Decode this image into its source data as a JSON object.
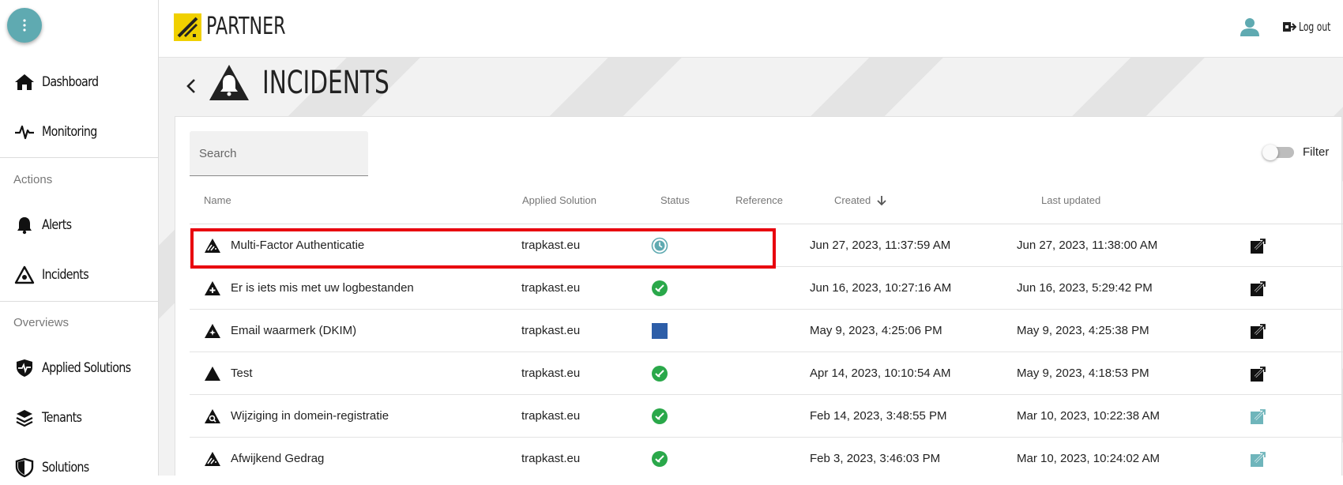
{
  "sidebar": {
    "nav": [
      {
        "label": "Dashboard",
        "icon": "home-icon"
      },
      {
        "label": "Monitoring",
        "icon": "pulse-icon"
      }
    ],
    "sections": [
      {
        "title": "Actions",
        "items": [
          {
            "label": "Alerts",
            "icon": "bell-icon"
          },
          {
            "label": "Incidents",
            "icon": "warning-triangle-icon"
          }
        ]
      },
      {
        "title": "Overviews",
        "items": [
          {
            "label": "Applied Solutions",
            "icon": "shield-pulse-icon"
          },
          {
            "label": "Tenants",
            "icon": "layers-icon"
          },
          {
            "label": "Solutions",
            "icon": "shield-icon"
          }
        ]
      }
    ]
  },
  "topbar": {
    "brand": "PARTNER",
    "logout_label": "Log out"
  },
  "page": {
    "title": "INCIDENTS"
  },
  "search": {
    "placeholder": "Search"
  },
  "filter": {
    "label": "Filter",
    "enabled": false
  },
  "table": {
    "columns": {
      "name": "Name",
      "applied_solution": "Applied Solution",
      "status": "Status",
      "reference": "Reference",
      "created": "Created",
      "last_updated": "Last updated"
    },
    "sort": {
      "column": "created",
      "direction": "desc"
    },
    "rows": [
      {
        "name": "Multi-Factor Authenticatie",
        "solution": "trapkast.eu",
        "status": "in-progress",
        "reference": "",
        "created": "Jun 27, 2023, 11:37:59 AM",
        "updated": "Jun 27, 2023, 11:38:00 AM",
        "icon": "incident-slash-icon",
        "highlighted": true,
        "link_active": true
      },
      {
        "name": "Er is iets mis met uw logbestanden",
        "solution": "trapkast.eu",
        "status": "resolved",
        "reference": "",
        "created": "Jun 16, 2023, 10:27:16 AM",
        "updated": "Jun 16, 2023, 5:29:42 PM",
        "icon": "incident-plus-icon",
        "highlighted": false,
        "link_active": true
      },
      {
        "name": "Email waarmerk (DKIM)",
        "solution": "trapkast.eu",
        "status": "new",
        "reference": "",
        "created": "May 9, 2023, 4:25:06 PM",
        "updated": "May 9, 2023, 4:25:38 PM",
        "icon": "incident-sparkle-icon",
        "highlighted": false,
        "link_active": true
      },
      {
        "name": "Test",
        "solution": "trapkast.eu",
        "status": "resolved",
        "reference": "",
        "created": "Apr 14, 2023, 10:10:54 AM",
        "updated": "May 9, 2023, 4:18:53 PM",
        "icon": "incident-solid-icon",
        "highlighted": false,
        "link_active": true
      },
      {
        "name": "Wijziging in domein-registratie",
        "solution": "trapkast.eu",
        "status": "resolved",
        "reference": "",
        "created": "Feb 14, 2023, 3:48:55 PM",
        "updated": "Mar 10, 2023, 10:22:38 AM",
        "icon": "incident-search-icon",
        "highlighted": false,
        "link_active": false
      },
      {
        "name": "Afwijkend Gedrag",
        "solution": "trapkast.eu",
        "status": "resolved",
        "reference": "",
        "created": "Feb 3, 2023, 3:46:03 PM",
        "updated": "Mar 10, 2023, 10:24:02 AM",
        "icon": "incident-slash-icon",
        "highlighted": false,
        "link_active": false
      }
    ]
  },
  "colors": {
    "accent": "#5faab1",
    "brand_yellow": "#f0d000",
    "status_resolved": "#2aa84a",
    "status_new": "#2d5ea8",
    "highlight": "#e8000e"
  }
}
